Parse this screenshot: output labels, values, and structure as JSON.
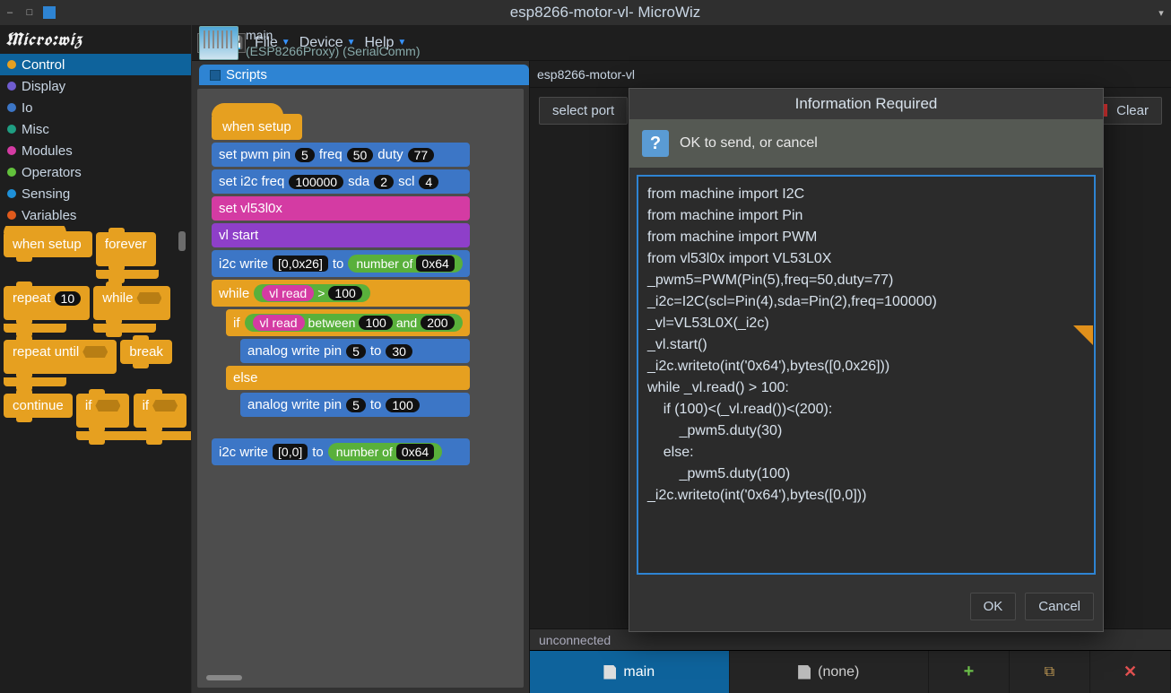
{
  "window": {
    "title": "esp8266-motor-vl- MicroWiz"
  },
  "logo_text": "Micro:wiz",
  "categories": [
    {
      "name": "Control",
      "color": "#e6a020",
      "selected": true
    },
    {
      "name": "Display",
      "color": "#6f5ccf",
      "selected": false
    },
    {
      "name": "Io",
      "color": "#3c76c6",
      "selected": false
    },
    {
      "name": "Misc",
      "color": "#1f9e82",
      "selected": false
    },
    {
      "name": "Modules",
      "color": "#d43ba3",
      "selected": false
    },
    {
      "name": "Operators",
      "color": "#62c13c",
      "selected": false
    },
    {
      "name": "Sensing",
      "color": "#1e90d8",
      "selected": false
    },
    {
      "name": "Variables",
      "color": "#e05a1c",
      "selected": false
    }
  ],
  "palette": {
    "hat_when_setup": "when setup",
    "forever": "forever",
    "repeat": "repeat",
    "repeat_n": "10",
    "while": "while",
    "repeat_until": "repeat until",
    "break": "break",
    "continue": "continue",
    "if1": "if",
    "if2": "if"
  },
  "menus": {
    "file": "File",
    "device": "Device",
    "help": "Help"
  },
  "project": {
    "name": "main",
    "proxy": "(ESP8266Proxy) (SerialComm)",
    "scripts_tab": "Scripts"
  },
  "script": {
    "when_setup": "when setup",
    "set_pwm": "set pwm pin",
    "pwm_pin": "5",
    "freq_l": "freq",
    "freq_v": "50",
    "duty_l": "duty",
    "duty_v": "77",
    "set_i2c": "set i2c freq",
    "i2c_freq": "100000",
    "sda_l": "sda",
    "sda_v": "2",
    "scl_l": "scl",
    "scl_v": "4",
    "set_vl": "set vl53l0x",
    "vl_start": "vl start",
    "i2c_write1": "i2c write",
    "i2c_bytes1": "[0,0x26]",
    "to": "to",
    "numof": "number of",
    "addr1": "0x64",
    "while": "while",
    "vl_read": "vl read",
    "gt": ">",
    "gt_v": "100",
    "if": "if",
    "between": "between",
    "bt_lo": "100",
    "and": "and",
    "bt_hi": "200",
    "aw": "analog write pin",
    "aw_pin1": "5",
    "aw_to": "to",
    "aw_v1": "30",
    "else": "else",
    "aw_pin2": "5",
    "aw_v2": "100",
    "i2c_write2": "i2c write",
    "i2c_bytes2": "[0,0]",
    "addr2": "0x64"
  },
  "terminal": {
    "tab_name": "esp8266-motor-vl",
    "select_port": "select port",
    "clear": "Clear",
    "status": "unconnected"
  },
  "bottombar": {
    "tab1": "main",
    "tab2": "(none)"
  },
  "dialog": {
    "title": "Information Required",
    "message": "OK to send, or cancel",
    "code": "from machine import I2C\nfrom machine import Pin\nfrom machine import PWM\nfrom vl53l0x import VL53L0X\n_pwm5=PWM(Pin(5),freq=50,duty=77)\n_i2c=I2C(scl=Pin(4),sda=Pin(2),freq=100000)\n_vl=VL53L0X(_i2c)\n_vl.start()\n_i2c.writeto(int('0x64'),bytes([0,0x26]))\nwhile _vl.read() > 100:\n    if (100)<(_vl.read())<(200):\n        _pwm5.duty(30)\n    else:\n        _pwm5.duty(100)\n_i2c.writeto(int('0x64'),bytes([0,0]))\n",
    "ok": "OK",
    "cancel": "Cancel"
  }
}
